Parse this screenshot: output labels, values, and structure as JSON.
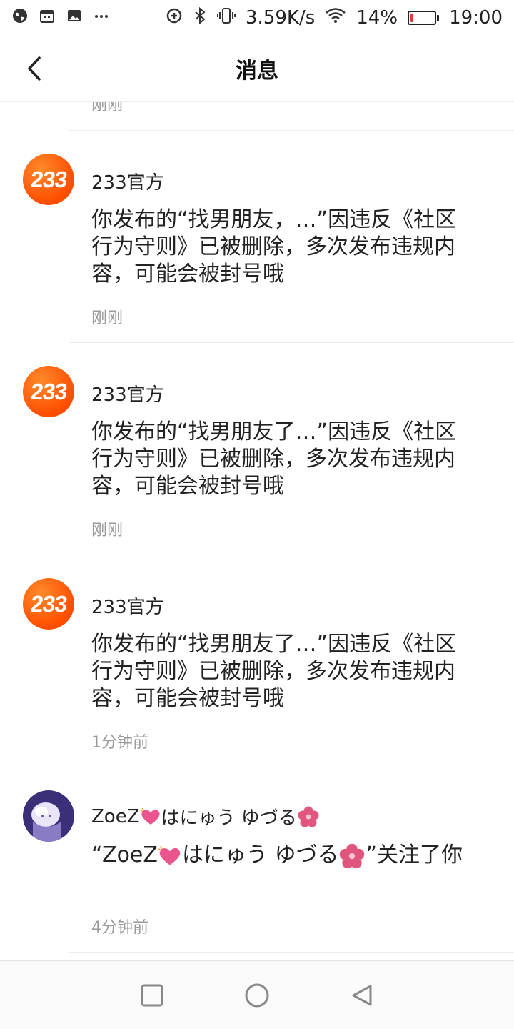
{
  "status_bar": {
    "net_speed": "3.59K/s",
    "battery_percent": "14%",
    "battery_level": 0.14,
    "time": "19:00",
    "left_icons": [
      "globe-icon",
      "calendar-icon",
      "image-icon",
      "more-dots-icon"
    ],
    "right_icons": [
      "data-saver-icon",
      "bluetooth-icon",
      "vibrate-icon",
      "wifi-icon",
      "battery-icon"
    ]
  },
  "header": {
    "title": "消息",
    "back_icon": "chevron-left-icon"
  },
  "previous_item": {
    "time": "刚刚"
  },
  "messages": [
    {
      "avatar_text": "233",
      "sender": "233官方",
      "text": "你发布的“找男朋友，…”因违反《社区行为守则》已被删除，多次发布违规内容，可能会被封号哦",
      "time": "刚刚"
    },
    {
      "avatar_text": "233",
      "sender": "233官方",
      "text": "你发布的“找男朋友了…”因违反《社区行为守则》已被删除，多次发布违规内容，可能会被封号哦",
      "time": "刚刚"
    },
    {
      "avatar_text": "233",
      "sender": "233官方",
      "text": "你发布的“找男朋友了…”因违反《社区行为守则》已被删除，多次发布违规内容，可能会被封号哦",
      "time": "1分钟前"
    },
    {
      "sender_part1": "ZoeZ",
      "sender_part2": "はにゅう ゆづる",
      "text_open": "“ZoeZ",
      "text_middle": "はにゅう ゆづる",
      "text_close": "”关注了你",
      "time": "4分钟前"
    }
  ],
  "nav_bar": {
    "icons": [
      "recent-apps-icon",
      "home-icon",
      "back-icon"
    ]
  },
  "colors": {
    "brand_orange": "#ff5a00",
    "muted_text": "#9a9a9a",
    "heart_pink": "#e8558f",
    "flower_pink": "#e0567e",
    "battery_low": "#e53935"
  }
}
